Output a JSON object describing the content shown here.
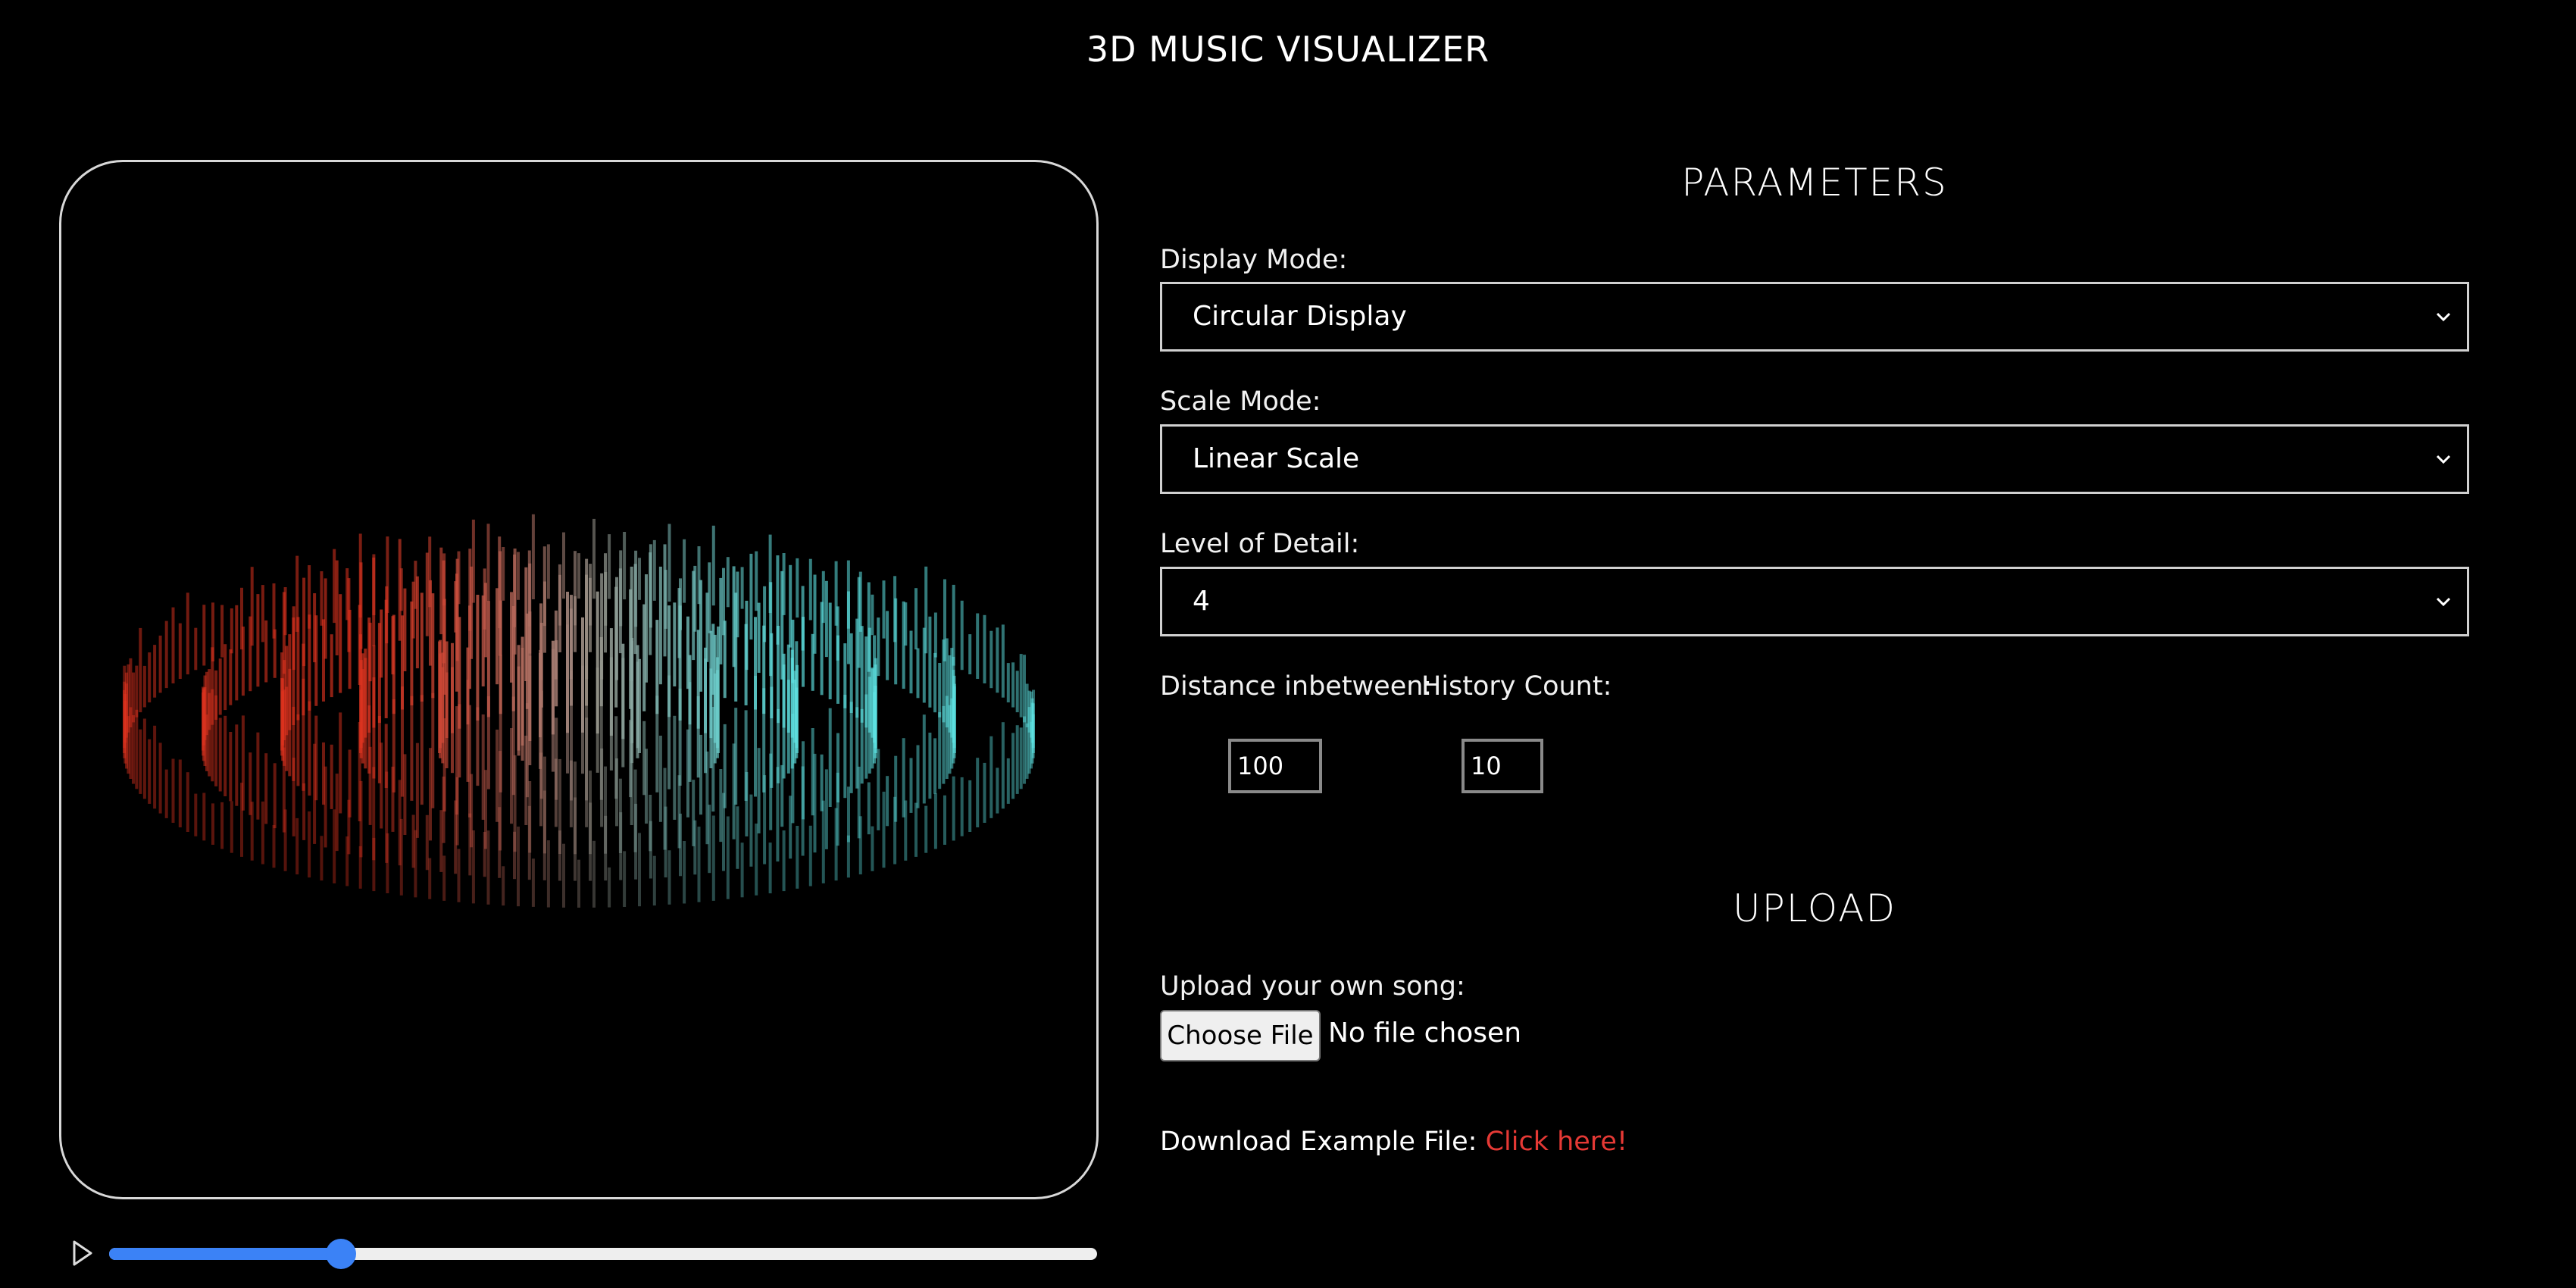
{
  "app": {
    "title": "3D MUSIC VISUALIZER"
  },
  "visualizer": {
    "colors": {
      "warm": "#e0331f",
      "cool": "#5fe6e6",
      "border": "#d8d8d8"
    },
    "rings": 6
  },
  "player": {
    "play_icon": "play-icon",
    "progress": 0.235,
    "accent": "#3b82f6"
  },
  "parameters": {
    "section_title": "PARAMETERS",
    "display_mode": {
      "label": "Display Mode:",
      "value": "Circular Display"
    },
    "scale_mode": {
      "label": "Scale Mode:",
      "value": "Linear Scale"
    },
    "level_of_detail": {
      "label": "Level of Detail:",
      "value": "4"
    },
    "distance": {
      "label": "Distance inbetween:",
      "value": "100"
    },
    "history": {
      "label": "History Count:",
      "value": "10"
    }
  },
  "upload": {
    "section_title": "UPLOAD",
    "label": "Upload your own song:",
    "button": "Choose File",
    "status": "No file chosen",
    "download_prefix": "Download Example File: ",
    "download_link": "Click here!",
    "link_color": "#e53935"
  }
}
